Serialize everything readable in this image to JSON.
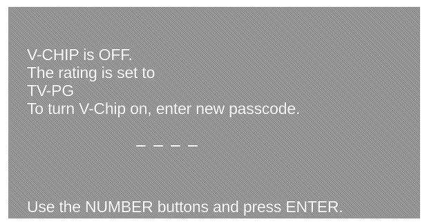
{
  "osd": {
    "status": "V-CHIP is OFF.",
    "rating_prefix": "The rating is set to",
    "rating_value": "TV-PG",
    "instruction": "To turn V-Chip on, enter new passcode.",
    "passcode_digits_entered": 0,
    "passcode_length": 4,
    "hint": "Use the NUMBER buttons and press ENTER."
  },
  "colors": {
    "background": "#939393",
    "text": "#ffffff"
  }
}
